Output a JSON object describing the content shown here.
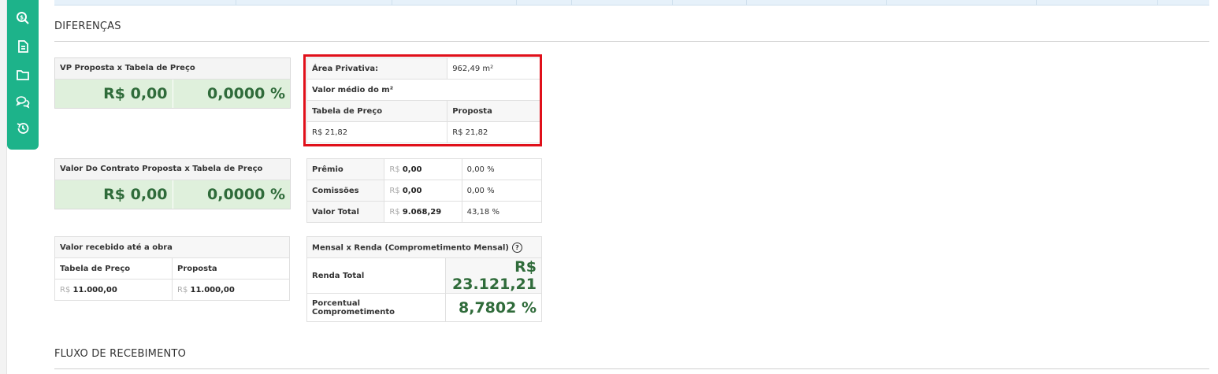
{
  "sections": {
    "differences": "DIFERENÇAS",
    "cashflow": "FLUXO DE RECEBIMENTO"
  },
  "sidebar_icons": [
    "search-dollar-icon",
    "document-icon",
    "folder-icon",
    "chat-icon",
    "history-icon"
  ],
  "vp_card": {
    "title": "VP Proposta x Tabela de Preço",
    "value": "R$ 0,00",
    "percent": "0,0000 %"
  },
  "contract_card": {
    "title": "Valor Do Contrato Proposta x Tabela de Preço",
    "value": "R$ 0,00",
    "percent": "0,0000 %"
  },
  "received_card": {
    "title": "Valor recebido até a obra",
    "col_table": "Tabela de Preço",
    "col_proposal": "Proposta",
    "currency": "R$",
    "table_value": "11.000,00",
    "proposal_value": "11.000,00"
  },
  "area_card": {
    "area_label": "Área Privativa:",
    "area_value": "962,49 m²",
    "avg_label": "Valor médio do m²",
    "col_table": "Tabela de Preço",
    "col_proposal": "Proposta",
    "table_value": "R$ 21,82",
    "proposal_value": "R$ 21,82"
  },
  "totals_card": {
    "rows": [
      {
        "label": "Prêmio",
        "currency": "R$",
        "value": "0,00",
        "percent": "0,00 %"
      },
      {
        "label": "Comissões",
        "currency": "R$",
        "value": "0,00",
        "percent": "0,00 %"
      },
      {
        "label": "Valor Total",
        "currency": "R$",
        "value": "9.068,29",
        "percent": "43,18 %"
      }
    ]
  },
  "income_card": {
    "title": "Mensal x Renda (Comprometimento Mensal)",
    "help": "?",
    "income_label": "Renda Total",
    "income_value": "R$ 23.121,21",
    "commitment_label": "Porcentual Comprometimento",
    "commitment_value": "8,7802 %"
  },
  "colors": {
    "accent": "#1db38a",
    "positive_text": "#2f6b3a",
    "positive_bg": "#dff0dc",
    "highlight": "#e0101a"
  }
}
